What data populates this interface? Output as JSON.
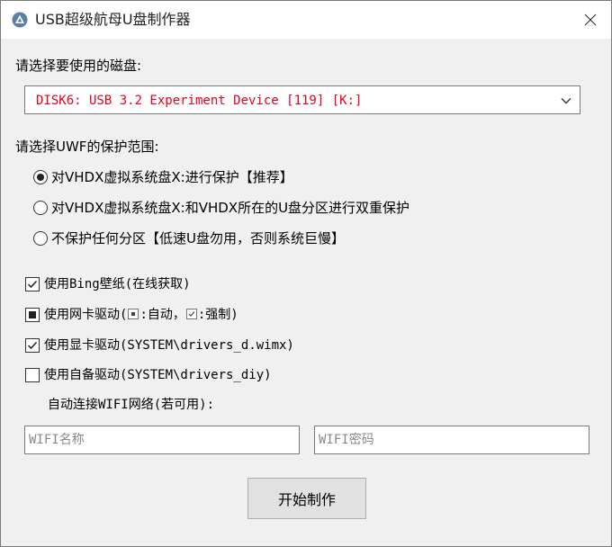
{
  "window": {
    "title": "USB超级航母U盘制作器"
  },
  "disk": {
    "label": "请选择要使用的磁盘:",
    "selected": "DISK6: USB 3.2 Experiment Device [119] [K:]",
    "text_color": "#e8001c"
  },
  "uwf": {
    "label": "请选择UWF的保护范围:",
    "options": [
      {
        "label": "对VHDX虚拟系统盘X:进行保护【推荐】",
        "checked": true
      },
      {
        "label": "对VHDX虚拟系统盘X:和VHDX所在的U盘分区进行双重保护",
        "checked": false
      },
      {
        "label": "不保护任何分区【低速U盘勿用，否则系统巨慢】",
        "checked": false
      }
    ]
  },
  "options": {
    "bing": {
      "label": "使用Bing壁纸(在线获取)",
      "state": "checked"
    },
    "nic": {
      "label_prefix": "使用网卡驱动(",
      "auto_label": ":自动，",
      "force_label": ":强制)",
      "state": "indeterminate"
    },
    "gpu": {
      "label": "使用显卡驱动(SYSTEM\\drivers_d.wimx)",
      "state": "checked"
    },
    "diy": {
      "label": "使用自备驱动(SYSTEM\\drivers_diy)",
      "state": "unchecked"
    }
  },
  "wifi": {
    "label": "自动连接WIFI网络(若可用):",
    "name_placeholder": "WIFI名称",
    "password_placeholder": "WIFI密码"
  },
  "actions": {
    "start_label": "开始制作"
  }
}
